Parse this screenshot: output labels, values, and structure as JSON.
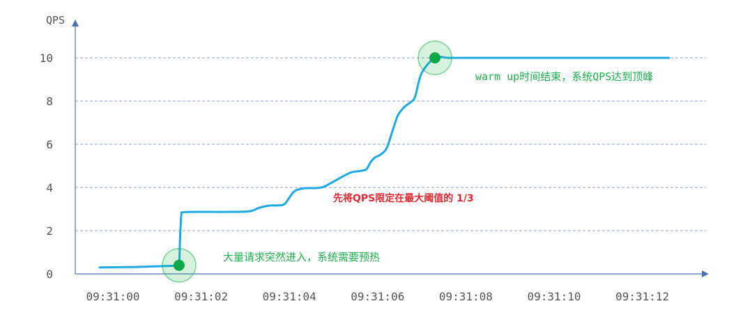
{
  "chart_data": {
    "type": "line",
    "ylabel": "QPS",
    "ylim": [
      0,
      11
    ],
    "yticks": [
      "0",
      "2",
      "4",
      "6",
      "8",
      "10"
    ],
    "xticks": [
      "09:31:00",
      "09:31:02",
      "09:31:04",
      "09:31:06",
      "09:31:08",
      "09:31:10",
      "09:31:12"
    ],
    "grid": "horizontal-dashed",
    "series": [
      {
        "color": "#1da9e6",
        "x": [
          -0.3,
          0.5,
          1.0,
          1.3,
          1.45,
          1.5,
          1.52,
          1.55,
          1.6,
          2.0,
          2.6,
          3.1,
          3.3,
          3.5,
          3.6,
          3.75,
          3.9,
          4.1,
          4.3,
          4.5,
          4.6,
          4.8,
          5.2,
          5.4,
          5.55,
          5.65,
          5.75,
          5.85,
          5.95,
          6.05,
          6.2,
          6.35,
          6.45,
          6.55,
          6.65,
          6.75,
          6.85,
          7.0,
          7.3,
          7.6,
          7.95,
          8.5,
          9.0,
          10.0,
          11.0,
          12.0,
          12.6
        ],
        "values": [
          0.3,
          0.32,
          0.35,
          0.37,
          0.38,
          0.4,
          1.5,
          2.7,
          2.85,
          2.87,
          2.87,
          2.9,
          3.05,
          3.15,
          3.17,
          3.17,
          3.25,
          3.8,
          3.95,
          3.97,
          3.97,
          4.05,
          4.5,
          4.7,
          4.75,
          4.78,
          4.85,
          5.2,
          5.4,
          5.5,
          5.8,
          6.7,
          7.3,
          7.6,
          7.8,
          7.95,
          8.2,
          9.3,
          10.0,
          10.0,
          10.0,
          10.0,
          10.0,
          10.0,
          10.0,
          10.0,
          10.0
        ]
      }
    ],
    "markers": [
      {
        "x": 1.5,
        "y": 0.4,
        "color": "#0ca84a"
      },
      {
        "x": 7.3,
        "y": 10.0,
        "color": "#0ca84a"
      }
    ],
    "annotations": [
      {
        "text": "大量请求突然进入，系统需要预热",
        "color": "#19b34a",
        "x": 1.5,
        "y": 0.4
      },
      {
        "text": "先将QPS限定在最大阈值的 1/3",
        "color": "#e8262e",
        "x": 4.0,
        "y": 3.5
      },
      {
        "text": "warm up时间结束，系统QPS达到顶峰",
        "color": "#19b34a",
        "x": 7.3,
        "y": 10.0
      }
    ],
    "axis_color": "#4a72b8",
    "grid_color": "#8aa0c6"
  }
}
